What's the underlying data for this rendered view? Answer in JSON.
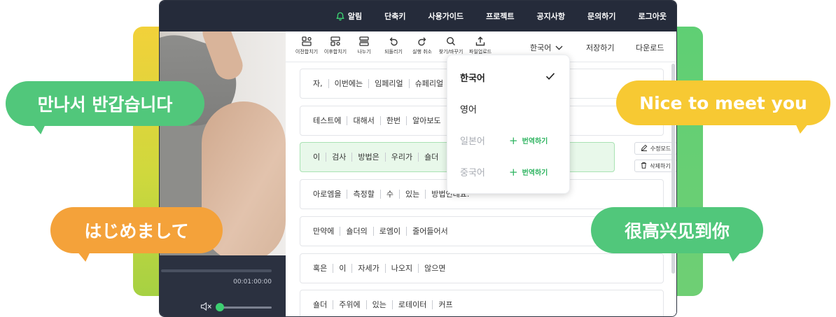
{
  "topnav": {
    "items": [
      {
        "label": "알림",
        "icon": "bell-icon"
      },
      {
        "label": "단축키"
      },
      {
        "label": "사용가이드"
      },
      {
        "label": "프로젝트"
      },
      {
        "label": "공지사항"
      },
      {
        "label": "문의하기"
      },
      {
        "label": "로그아웃"
      }
    ]
  },
  "player": {
    "timecode": "00:01:00:00",
    "progress": 0.0,
    "volume": 0.0
  },
  "toolbar": {
    "tools": [
      {
        "label": "이전합치기",
        "icon": "merge-previous-icon"
      },
      {
        "label": "이후합치기",
        "icon": "merge-next-icon"
      },
      {
        "label": "나누기",
        "icon": "split-icon"
      },
      {
        "label": "되돌리기",
        "icon": "undo-icon"
      },
      {
        "label": "실행 취소",
        "icon": "redo-icon"
      },
      {
        "label": "찾기/바꾸기",
        "icon": "search-icon"
      },
      {
        "label": "파일업로드",
        "icon": "upload-icon"
      }
    ],
    "language": "한국어",
    "save": "저장하기",
    "download": "다운로드"
  },
  "subtitles": [
    {
      "words": [
        "자,",
        "이번에는",
        "임페리얼",
        "슈페리얼"
      ],
      "selected": false
    },
    {
      "words": [
        "테스트에",
        "대해서",
        "한번",
        "알아보도"
      ],
      "selected": false
    },
    {
      "words": [
        "이",
        "검사",
        "방법은",
        "우리가",
        "숄더"
      ],
      "selected": true
    },
    {
      "words": [
        "아로엠을",
        "측정할",
        "수",
        "있는",
        "방법인데요."
      ],
      "selected": false
    },
    {
      "words": [
        "만약에",
        "숄더의",
        "로엠이",
        "줄어들어서"
      ],
      "selected": false
    },
    {
      "words": [
        "혹은",
        "이",
        "자세가",
        "나오지",
        "않으면"
      ],
      "selected": false
    },
    {
      "words": [
        "숄더",
        "주위에",
        "있는",
        "로테이터",
        "커프"
      ],
      "selected": false
    }
  ],
  "row_actions": {
    "edit": "수정모드",
    "delete": "삭제하기"
  },
  "language_dropdown": {
    "options": [
      {
        "label": "한국어",
        "selected": true,
        "available": true
      },
      {
        "label": "영어",
        "selected": false,
        "available": true
      },
      {
        "label": "일본어",
        "selected": false,
        "available": false,
        "action": "번역하기"
      },
      {
        "label": "중국어",
        "selected": false,
        "available": false,
        "action": "번역하기"
      }
    ]
  },
  "bubbles": {
    "korean": "만나서 반갑습니다",
    "english": "Nice to meet you",
    "japanese": "はじめまして",
    "chinese": "很高兴见到你"
  },
  "colors": {
    "accent_green": "#51c77b",
    "accent_yellow": "#f7c933",
    "accent_orange": "#f4a23a",
    "topbar": "#252b3a",
    "selected_row": "#e8f8ea",
    "translate_action": "#2db35f"
  }
}
